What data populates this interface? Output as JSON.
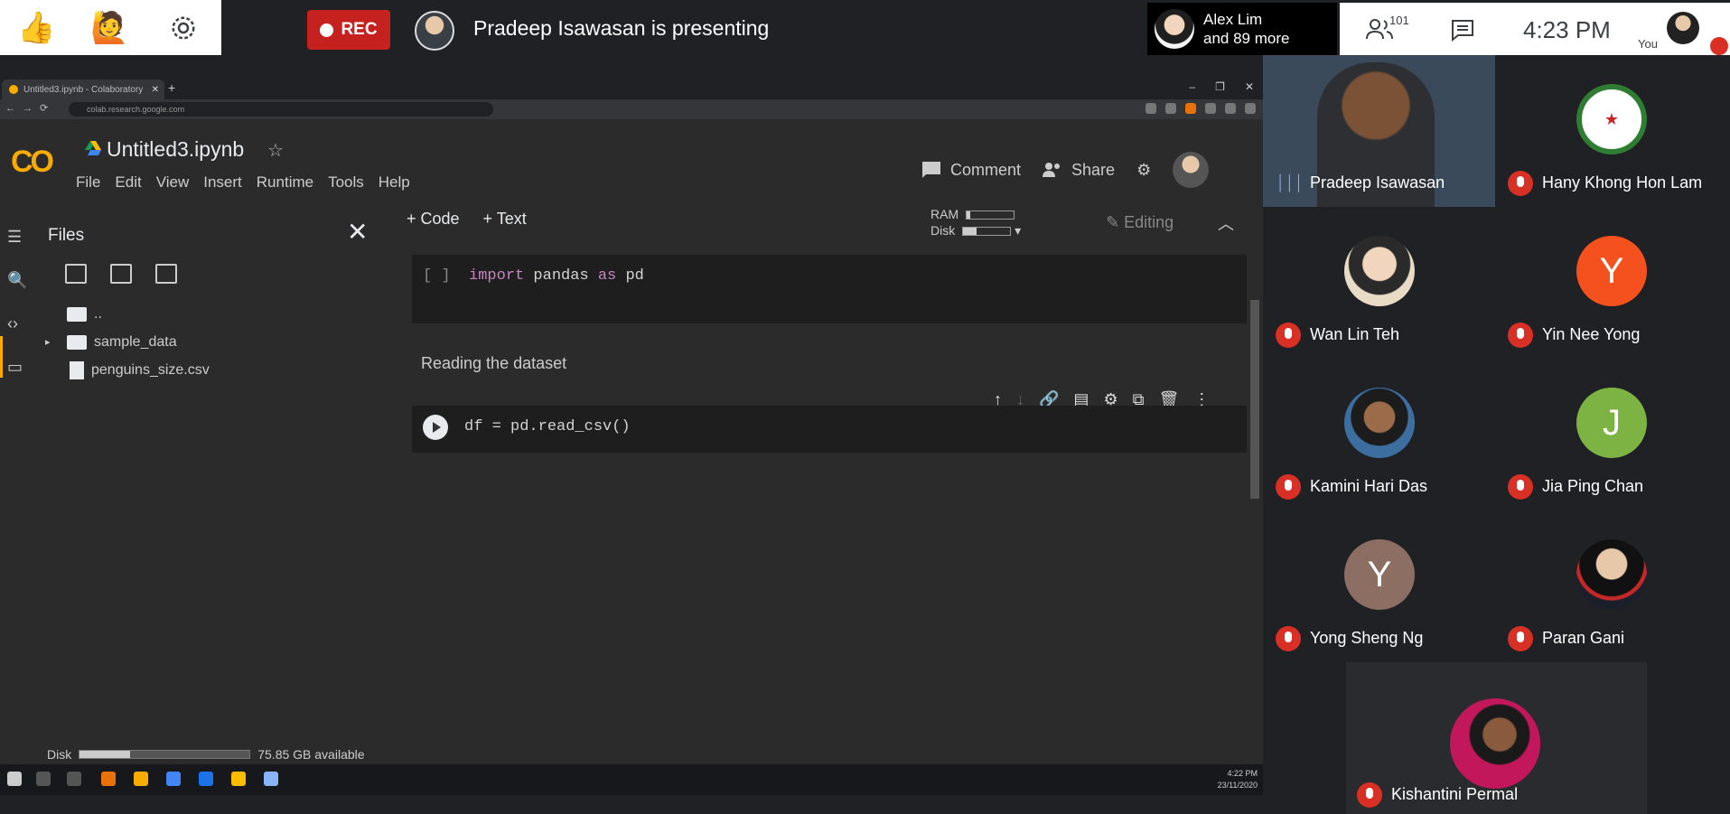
{
  "meeting": {
    "rec_label": "REC",
    "presenting_text": "Pradeep Isawasan is presenting",
    "alex_line1": "Alex Lim",
    "alex_line2": "and 89 more",
    "participant_count": "101",
    "time": "4:23  PM",
    "you_label": "You",
    "reactions": [
      "thumbs-up",
      "raise-hand",
      "settings"
    ]
  },
  "browser": {
    "tab_title": "Untitled3.ipynb - Colaboratory",
    "url": "colab.research.google.com"
  },
  "colab": {
    "notebook_title": "Untitled3.ipynb",
    "menus": [
      "File",
      "Edit",
      "View",
      "Insert",
      "Runtime",
      "Tools",
      "Help"
    ],
    "comment_label": "Comment",
    "share_label": "Share",
    "add_code": "+ Code",
    "add_text": "+ Text",
    "ram_label": "RAM",
    "disk_label": "Disk",
    "editing_label": "Editing",
    "files_title": "Files",
    "tree": [
      {
        "type": "parent",
        "name": ".."
      },
      {
        "type": "folder",
        "name": "sample_data"
      },
      {
        "type": "file",
        "name": "penguins_size.csv"
      }
    ],
    "disk_footer_label": "Disk",
    "disk_available": "75.85 GB available",
    "cell1_bracket": "[ ]",
    "cell1_code": {
      "kw1": "import",
      "rest1": " pandas ",
      "kw2": "as",
      "rest2": " pd"
    },
    "markdown": "Reading the dataset",
    "cell2_code": "df = pd.read_csv()"
  },
  "taskbar": {
    "time": "4:22 PM",
    "date": "23/11/2020"
  },
  "participants": [
    {
      "name": "Pradeep Isawasan",
      "speaking": true,
      "video": true
    },
    {
      "name": "Hany Khong Hon Lam",
      "initial": "",
      "color": "#ffffff",
      "muted": true
    },
    {
      "name": "Wan Lin Teh",
      "initial": "",
      "color": "#f3e3c8",
      "muted": true
    },
    {
      "name": "Yin Nee Yong",
      "initial": "Y",
      "color": "#f4511e",
      "muted": true
    },
    {
      "name": "Kamini Hari Das",
      "initial": "",
      "color": "#3c6fa0",
      "muted": true
    },
    {
      "name": "Jia Ping Chan",
      "initial": "J",
      "color": "#7cb342",
      "muted": true
    },
    {
      "name": "Yong Sheng Ng",
      "initial": "Y",
      "color": "#8d6e63",
      "muted": true
    },
    {
      "name": "Paran Gani",
      "initial": "",
      "color": "#1b1f2a",
      "muted": true
    },
    {
      "name": "Kishantini Permal",
      "initial": "",
      "color": "#c2185b",
      "muted": true
    }
  ]
}
